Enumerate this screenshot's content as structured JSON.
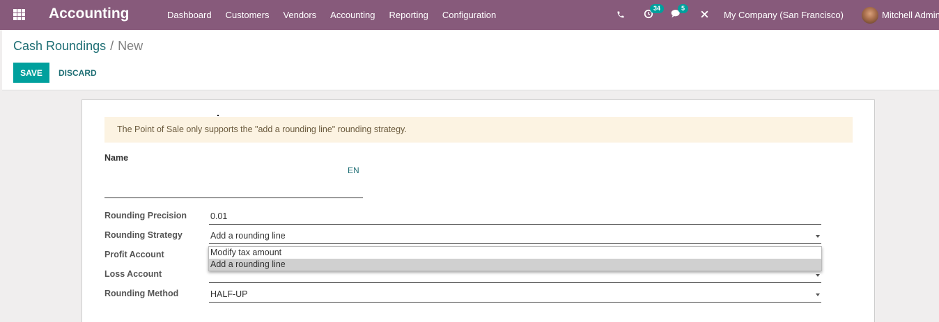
{
  "navbar": {
    "brand": "Accounting",
    "menu": [
      "Dashboard",
      "Customers",
      "Vendors",
      "Accounting",
      "Reporting",
      "Configuration"
    ],
    "activities_count": "34",
    "messages_count": "5",
    "company": "My Company (San Francisco)",
    "user": "Mitchell Admin"
  },
  "breadcrumb": {
    "parent": "Cash Roundings",
    "separator": "/",
    "current": "New"
  },
  "buttons": {
    "save": "SAVE",
    "discard": "DISCARD"
  },
  "alert": "The Point of Sale only supports the \"add a rounding line\" rounding strategy.",
  "form": {
    "name_label": "Name",
    "name_value": "",
    "lang": "EN",
    "precision_label": "Rounding Precision",
    "precision_value": "0.01",
    "strategy_label": "Rounding Strategy",
    "strategy_value": "Add a rounding line",
    "profit_label": "Profit Account",
    "loss_label": "Loss Account",
    "method_label": "Rounding Method",
    "method_value": "HALF-UP"
  },
  "dropdown": {
    "options": [
      "Modify tax amount",
      "Add a rounding line"
    ],
    "selected_index": 1
  },
  "colors": {
    "navbar": "#875a7b",
    "primary": "#00a09d",
    "link": "#1f6f75",
    "alert_bg": "#fcf3e2"
  },
  "icons": [
    "apps-grid-icon",
    "phone-icon",
    "activity-clock-icon",
    "chat-icon",
    "tools-icon"
  ]
}
